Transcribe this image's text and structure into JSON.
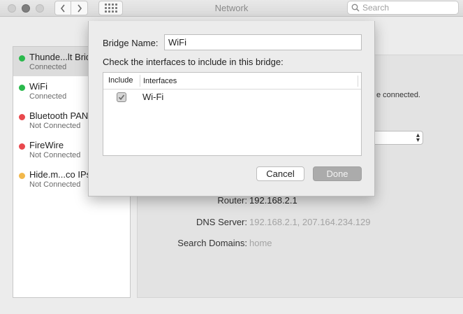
{
  "window": {
    "title": "Network",
    "search_placeholder": "Search"
  },
  "services": [
    {
      "name": "Thunde...lt Bridge",
      "status": "Connected",
      "dot_color": "#2ab94c",
      "selected": true
    },
    {
      "name": "WiFi",
      "status": "Connected",
      "dot_color": "#2ab94c"
    },
    {
      "name": "Bluetooth PAN",
      "status": "Not Connected",
      "dot_color": "#e9484d"
    },
    {
      "name": "FireWire",
      "status": "Not Connected",
      "dot_color": "#e9484d"
    },
    {
      "name": "Hide.m...co IPsec",
      "status": "Not Connected",
      "dot_color": "#f2b84b"
    }
  ],
  "panel": {
    "connected_note": "e connected.",
    "router_label": "Router:",
    "router_value": "192.168.2.1",
    "dns_label": "DNS Server:",
    "dns_value": "192.168.2.1, 207.164.234.129",
    "search_domains_label": "Search Domains:",
    "search_domains_value": "home"
  },
  "sheet": {
    "bridge_name_label": "Bridge Name:",
    "bridge_name_value": "WiFi",
    "check_prompt": "Check the interfaces to include in this bridge:",
    "table": {
      "col_include": "Include",
      "col_interfaces": "Interfaces",
      "rows": [
        {
          "interface": "Wi-Fi",
          "included": true
        }
      ]
    },
    "cancel_label": "Cancel",
    "done_label": "Done"
  }
}
